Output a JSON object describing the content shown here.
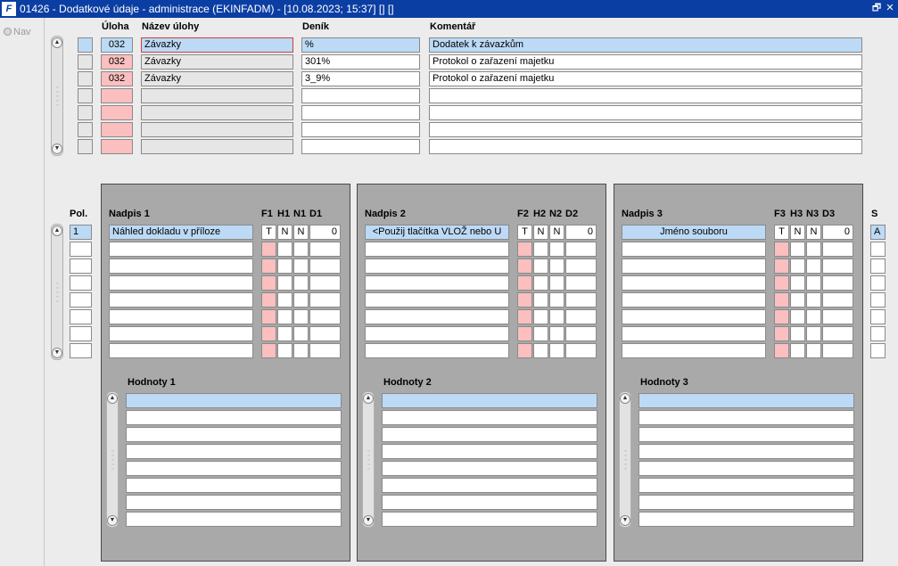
{
  "window": {
    "title": "01426 - Dodatkové údaje - administrace (EKINFADM) - [10.08.2023; 15:37] [] []",
    "app_icon": "F",
    "restore_glyph": "🗗",
    "close_glyph": "✕"
  },
  "nav": {
    "label": "Nav"
  },
  "top_grid": {
    "headers": {
      "uloha": "Úloha",
      "nazev": "Název úlohy",
      "denik": "Deník",
      "komentar": "Komentář"
    },
    "rows": [
      {
        "uloha": "032",
        "nazev": "Závazky",
        "denik": "%",
        "komentar": "Dodatek k závazkům"
      },
      {
        "uloha": "032",
        "nazev": "Závazky",
        "denik": "301%",
        "komentar": "Protokol o zařazení majetku"
      },
      {
        "uloha": "032",
        "nazev": "Závazky",
        "denik": "3_9%",
        "komentar": "Protokol o zařazení majetku"
      },
      {
        "uloha": "",
        "nazev": "",
        "denik": "",
        "komentar": ""
      },
      {
        "uloha": "",
        "nazev": "",
        "denik": "",
        "komentar": ""
      },
      {
        "uloha": "",
        "nazev": "",
        "denik": "",
        "komentar": ""
      },
      {
        "uloha": "",
        "nazev": "",
        "denik": "",
        "komentar": ""
      }
    ]
  },
  "pol": {
    "header": "Pol.",
    "values": [
      "1",
      "",
      "",
      "",
      "",
      "",
      "",
      ""
    ]
  },
  "sections": [
    {
      "nadpis_header": "Nadpis 1",
      "f": "F1",
      "h": "H1",
      "n": "N1",
      "d": "D1",
      "first_row": {
        "nadpis": "Náhled dokladu v příloze",
        "f": "T",
        "h": "N",
        "n": "N",
        "d": "0"
      },
      "hodnoty_header": "Hodnoty 1"
    },
    {
      "nadpis_header": "Nadpis 2",
      "f": "F2",
      "h": "H2",
      "n": "N2",
      "d": "D2",
      "first_row": {
        "nadpis": "<Použij tlačítka VLOŽ nebo U",
        "f": "T",
        "h": "N",
        "n": "N",
        "d": "0"
      },
      "hodnoty_header": "Hodnoty 2"
    },
    {
      "nadpis_header": "Nadpis 3",
      "f": "F3",
      "h": "H3",
      "n": "N3",
      "d": "D3",
      "first_row": {
        "nadpis": "Jméno souboru",
        "f": "T",
        "h": "N",
        "n": "N",
        "d": "0"
      },
      "hodnoty_header": "Hodnoty 3"
    }
  ],
  "s_column": {
    "header": "S",
    "first_value": "A"
  },
  "colors": {
    "titlebar": "#0b3ea3",
    "selected": "#bcdaf6",
    "required": "#fbbfbf",
    "section_bg": "#a9a9a9"
  }
}
